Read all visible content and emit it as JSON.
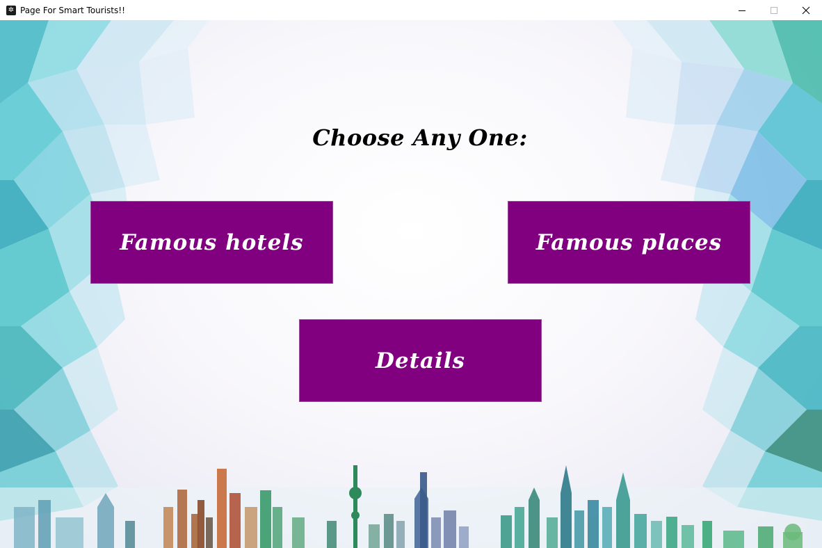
{
  "window": {
    "title": "Page For Smart Tourists!!",
    "controls": [
      "minimize-icon",
      "maximize-icon",
      "close-icon"
    ]
  },
  "main": {
    "heading": "Choose Any One:",
    "buttons": [
      {
        "label": "Famous hotels"
      },
      {
        "label": "Famous places"
      },
      {
        "label": "Details"
      }
    ]
  },
  "colors": {
    "button_bg": "#800080",
    "button_text": "#ffffff",
    "heading_text": "#000000",
    "crystal_teal": "#4fd0d8",
    "crystal_blue": "#8fc6ea",
    "skyline_green": "#3a9a6a"
  }
}
